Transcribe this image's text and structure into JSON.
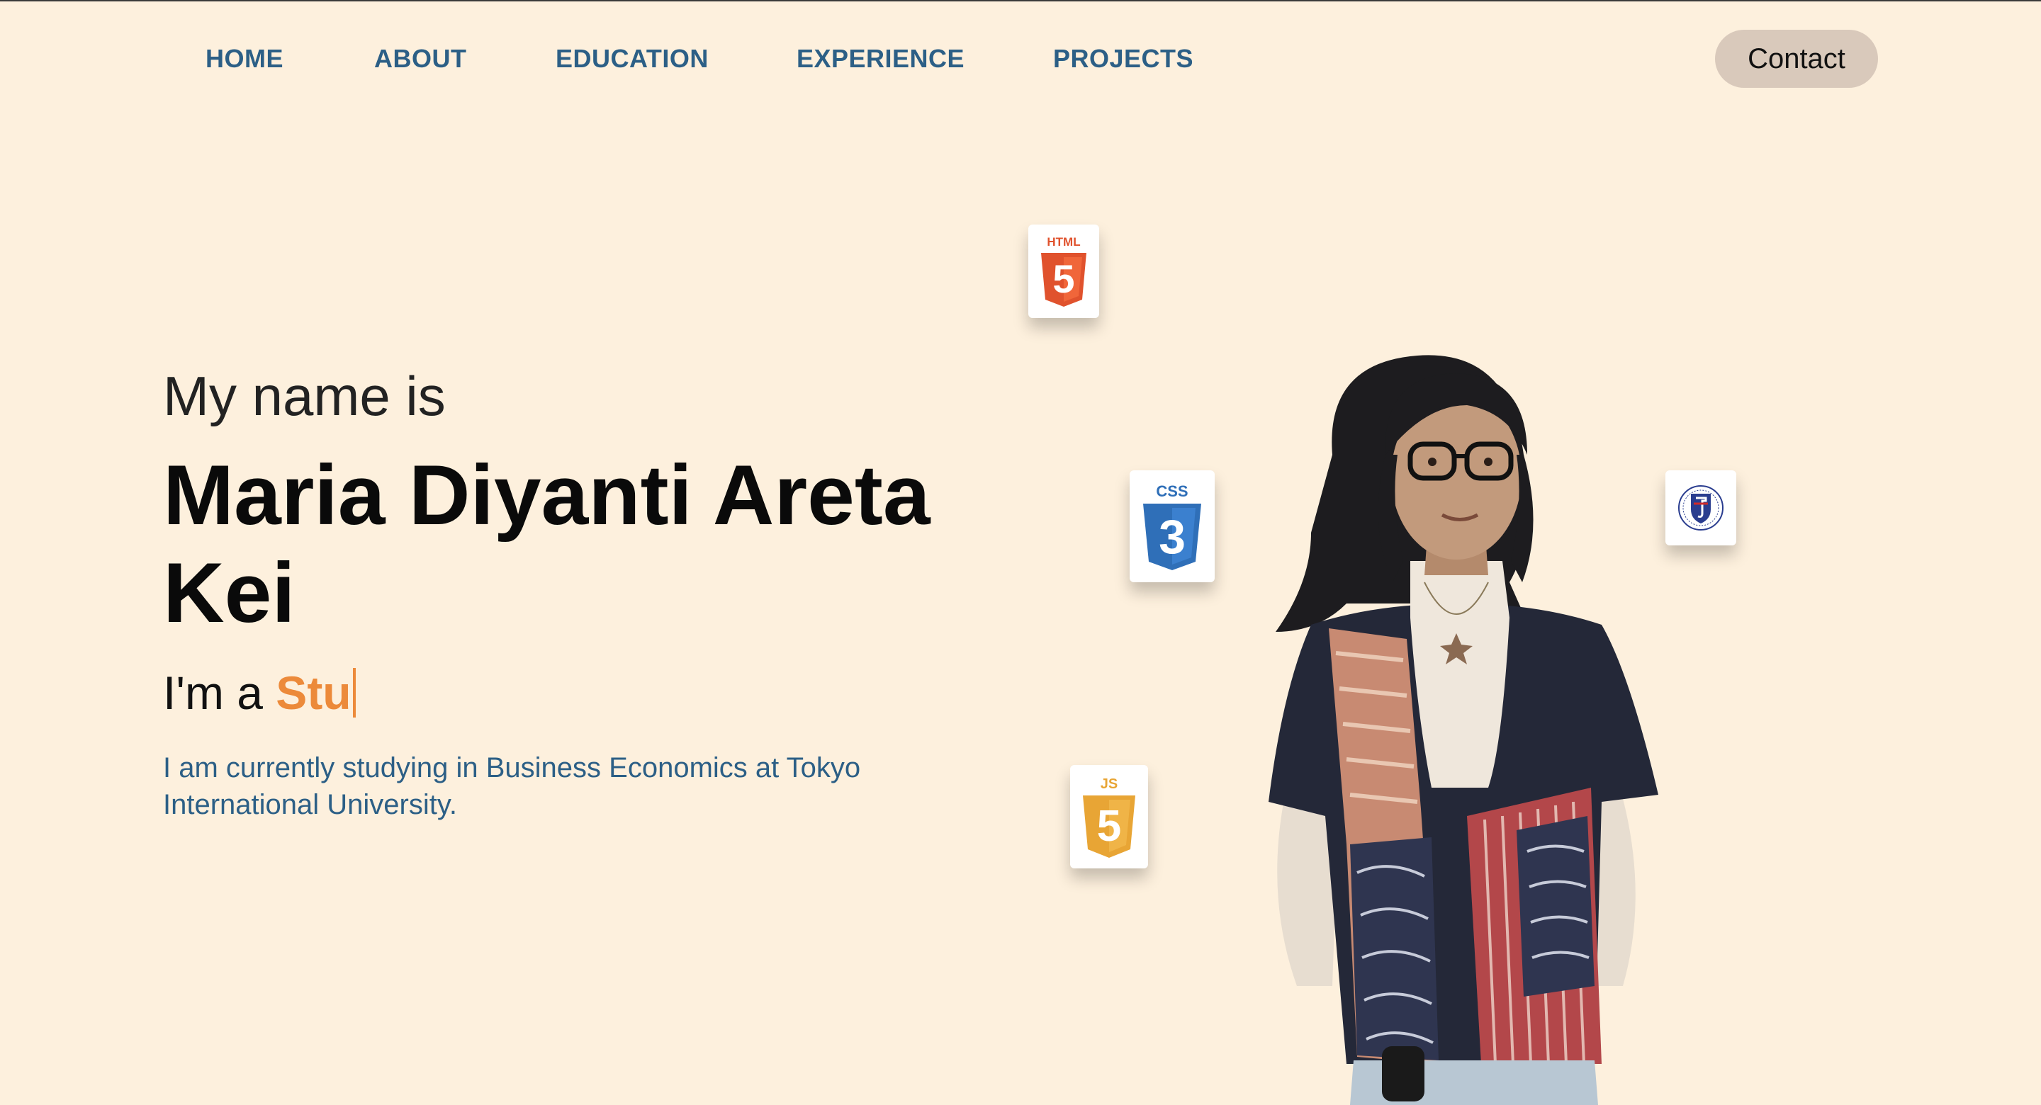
{
  "nav": {
    "items": [
      {
        "label": "HOME"
      },
      {
        "label": "ABOUT"
      },
      {
        "label": "EDUCATION"
      },
      {
        "label": "EXPERIENCE"
      },
      {
        "label": "PROJECTS"
      }
    ],
    "contact_label": "Contact"
  },
  "hero": {
    "intro": "My name is",
    "name": "Maria Diyanti Areta Kei",
    "role_prefix": "I'm a ",
    "role_typed": "Stu",
    "description": "I am currently studying in Business Economics at Tokyo International University."
  },
  "badges": {
    "html_label": "HTML",
    "css_label": "CSS",
    "js_label": "JS",
    "html_numeral": "5",
    "css_numeral": "3",
    "js_numeral": "5"
  },
  "icons": {
    "html": "html5-icon",
    "css": "css3-icon",
    "js": "javascript-icon",
    "university": "university-crest-icon"
  },
  "colors": {
    "background": "#fdf0dd",
    "nav_link": "#2c5f86",
    "accent": "#ec8a3a",
    "contact_bg": "#d9c9bb",
    "html": "#e0522d",
    "css": "#2f6fb8",
    "js": "#e8a535"
  }
}
